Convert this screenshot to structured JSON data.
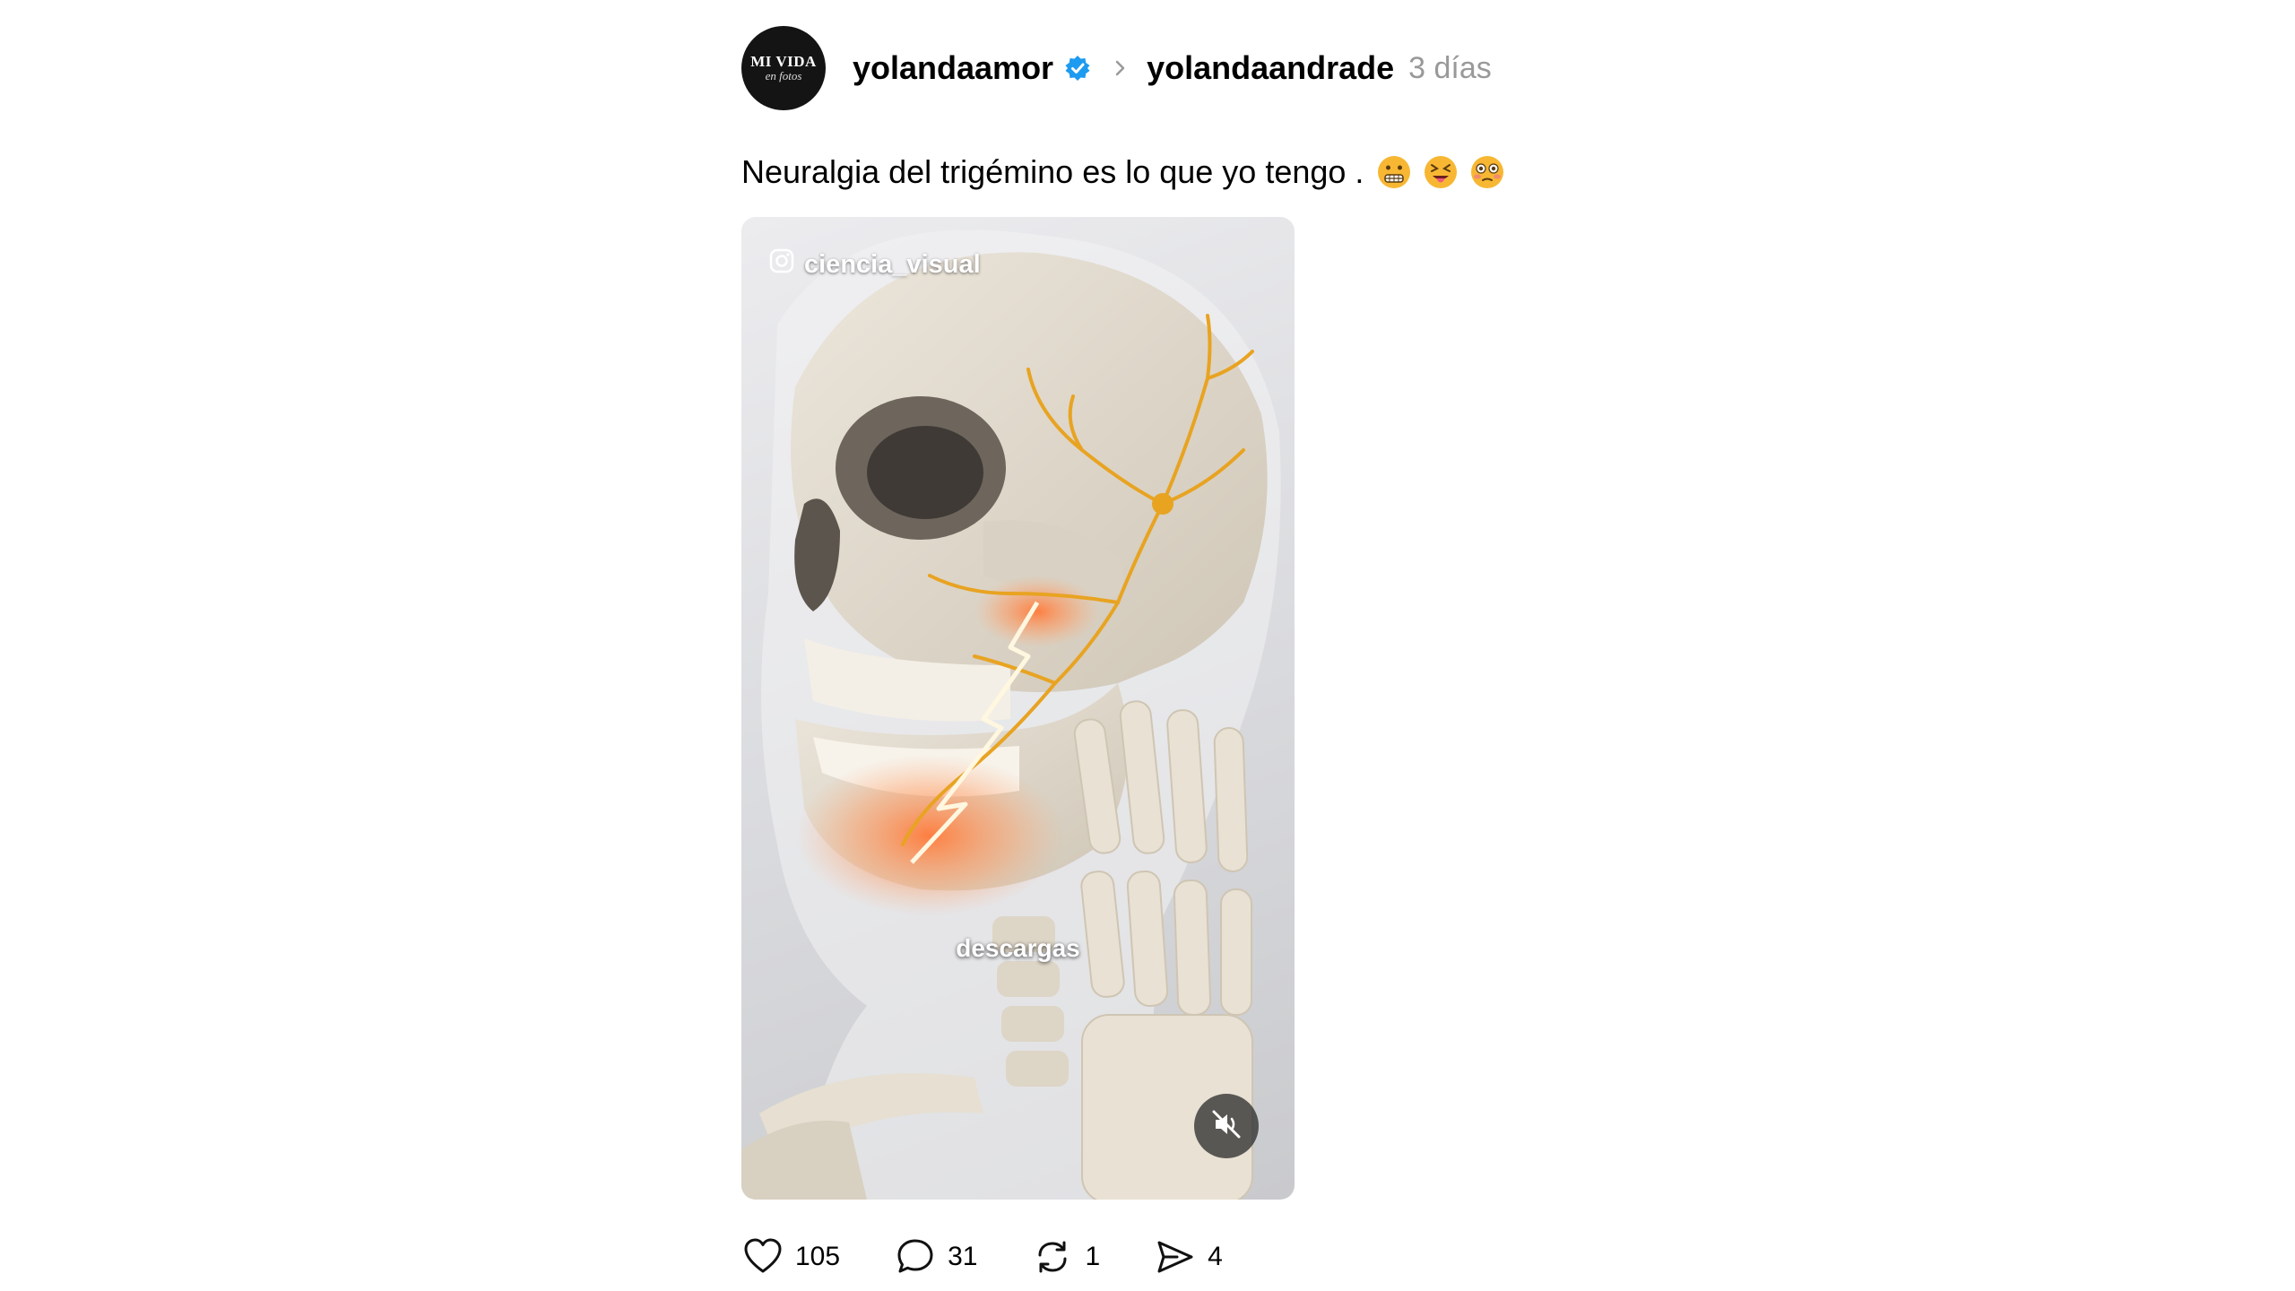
{
  "post": {
    "author": {
      "avatar_text_line1": "MI VIDA",
      "avatar_text_line2": "en fotos",
      "username": "yolandaamor",
      "verified_icon": "verified-badge-icon",
      "verified_color": "#1d9bf0"
    },
    "reply_to": "yolandaandrade",
    "timestamp": "3 días",
    "caption": "Neuralgia del trigémino es lo que yo tengo .",
    "caption_emojis": [
      "grimacing-face",
      "face-with-tongue",
      "flushed-face"
    ],
    "media": {
      "watermark": "ciencia_visual",
      "watermark_icon": "instagram-icon",
      "subtitle": "descargas",
      "mute_icon": "speaker-muted-icon"
    },
    "actions": {
      "likes": "105",
      "comments": "31",
      "reposts": "1",
      "shares": "4"
    }
  }
}
